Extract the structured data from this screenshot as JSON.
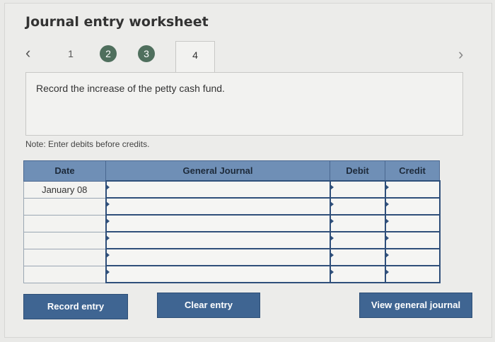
{
  "title": "Journal entry worksheet",
  "nav": {
    "prev_icon": "‹",
    "next_icon": "›",
    "steps": [
      "1",
      "2",
      "3",
      "4"
    ]
  },
  "prompt": "Record the increase of the petty cash fund.",
  "note": "Note: Enter debits before credits.",
  "table": {
    "headers": [
      "Date",
      "General Journal",
      "Debit",
      "Credit"
    ],
    "rows": [
      {
        "date": "January 08",
        "account": "",
        "debit": "",
        "credit": ""
      },
      {
        "date": "",
        "account": "",
        "debit": "",
        "credit": ""
      },
      {
        "date": "",
        "account": "",
        "debit": "",
        "credit": ""
      },
      {
        "date": "",
        "account": "",
        "debit": "",
        "credit": ""
      },
      {
        "date": "",
        "account": "",
        "debit": "",
        "credit": ""
      },
      {
        "date": "",
        "account": "",
        "debit": "",
        "credit": ""
      }
    ]
  },
  "buttons": {
    "record": "Record entry",
    "clear": "Clear entry",
    "view": "View general journal"
  },
  "colors": {
    "header_bg": "#6f8fb6",
    "button_bg": "#3f6592",
    "step_done_bg": "#4f6f5d"
  }
}
